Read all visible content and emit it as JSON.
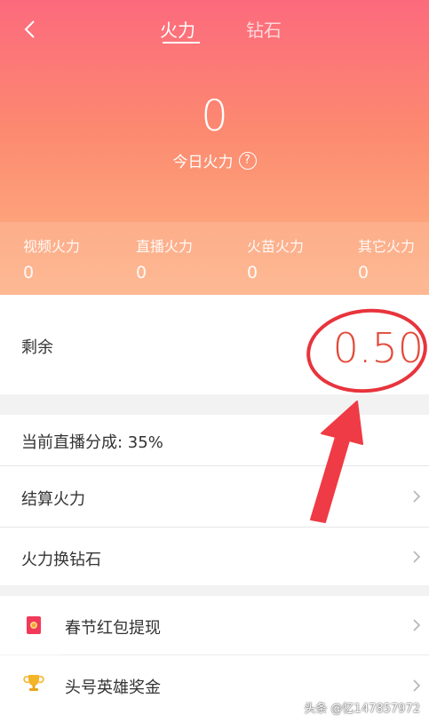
{
  "tabs": [
    {
      "label": "火力",
      "active": true
    },
    {
      "label": "钻石",
      "active": false
    }
  ],
  "today": {
    "value": "0",
    "label": "今日火力",
    "help": "?"
  },
  "stats": [
    {
      "label": "视频火力",
      "value": "0"
    },
    {
      "label": "直播火力",
      "value": "0"
    },
    {
      "label": "火苗火力",
      "value": "0"
    },
    {
      "label": "其它火力",
      "value": "0"
    }
  ],
  "remaining": {
    "label": "剩余",
    "value": "0.50"
  },
  "rows": [
    {
      "label": "当前直播分成: 35%"
    },
    {
      "label": "结算火力"
    },
    {
      "label": "火力换钻石"
    }
  ],
  "list": [
    {
      "label": "春节红包提现",
      "icon": "red-envelope-icon"
    },
    {
      "label": "头号英雄奖金",
      "icon": "trophy-icon"
    }
  ],
  "watermark": "头条 @忆147857972",
  "colors": {
    "accent_red": "#e24a3a",
    "header_top": "#fc6a7d",
    "header_bottom": "#fdb085",
    "annotation": "#e8343c"
  }
}
